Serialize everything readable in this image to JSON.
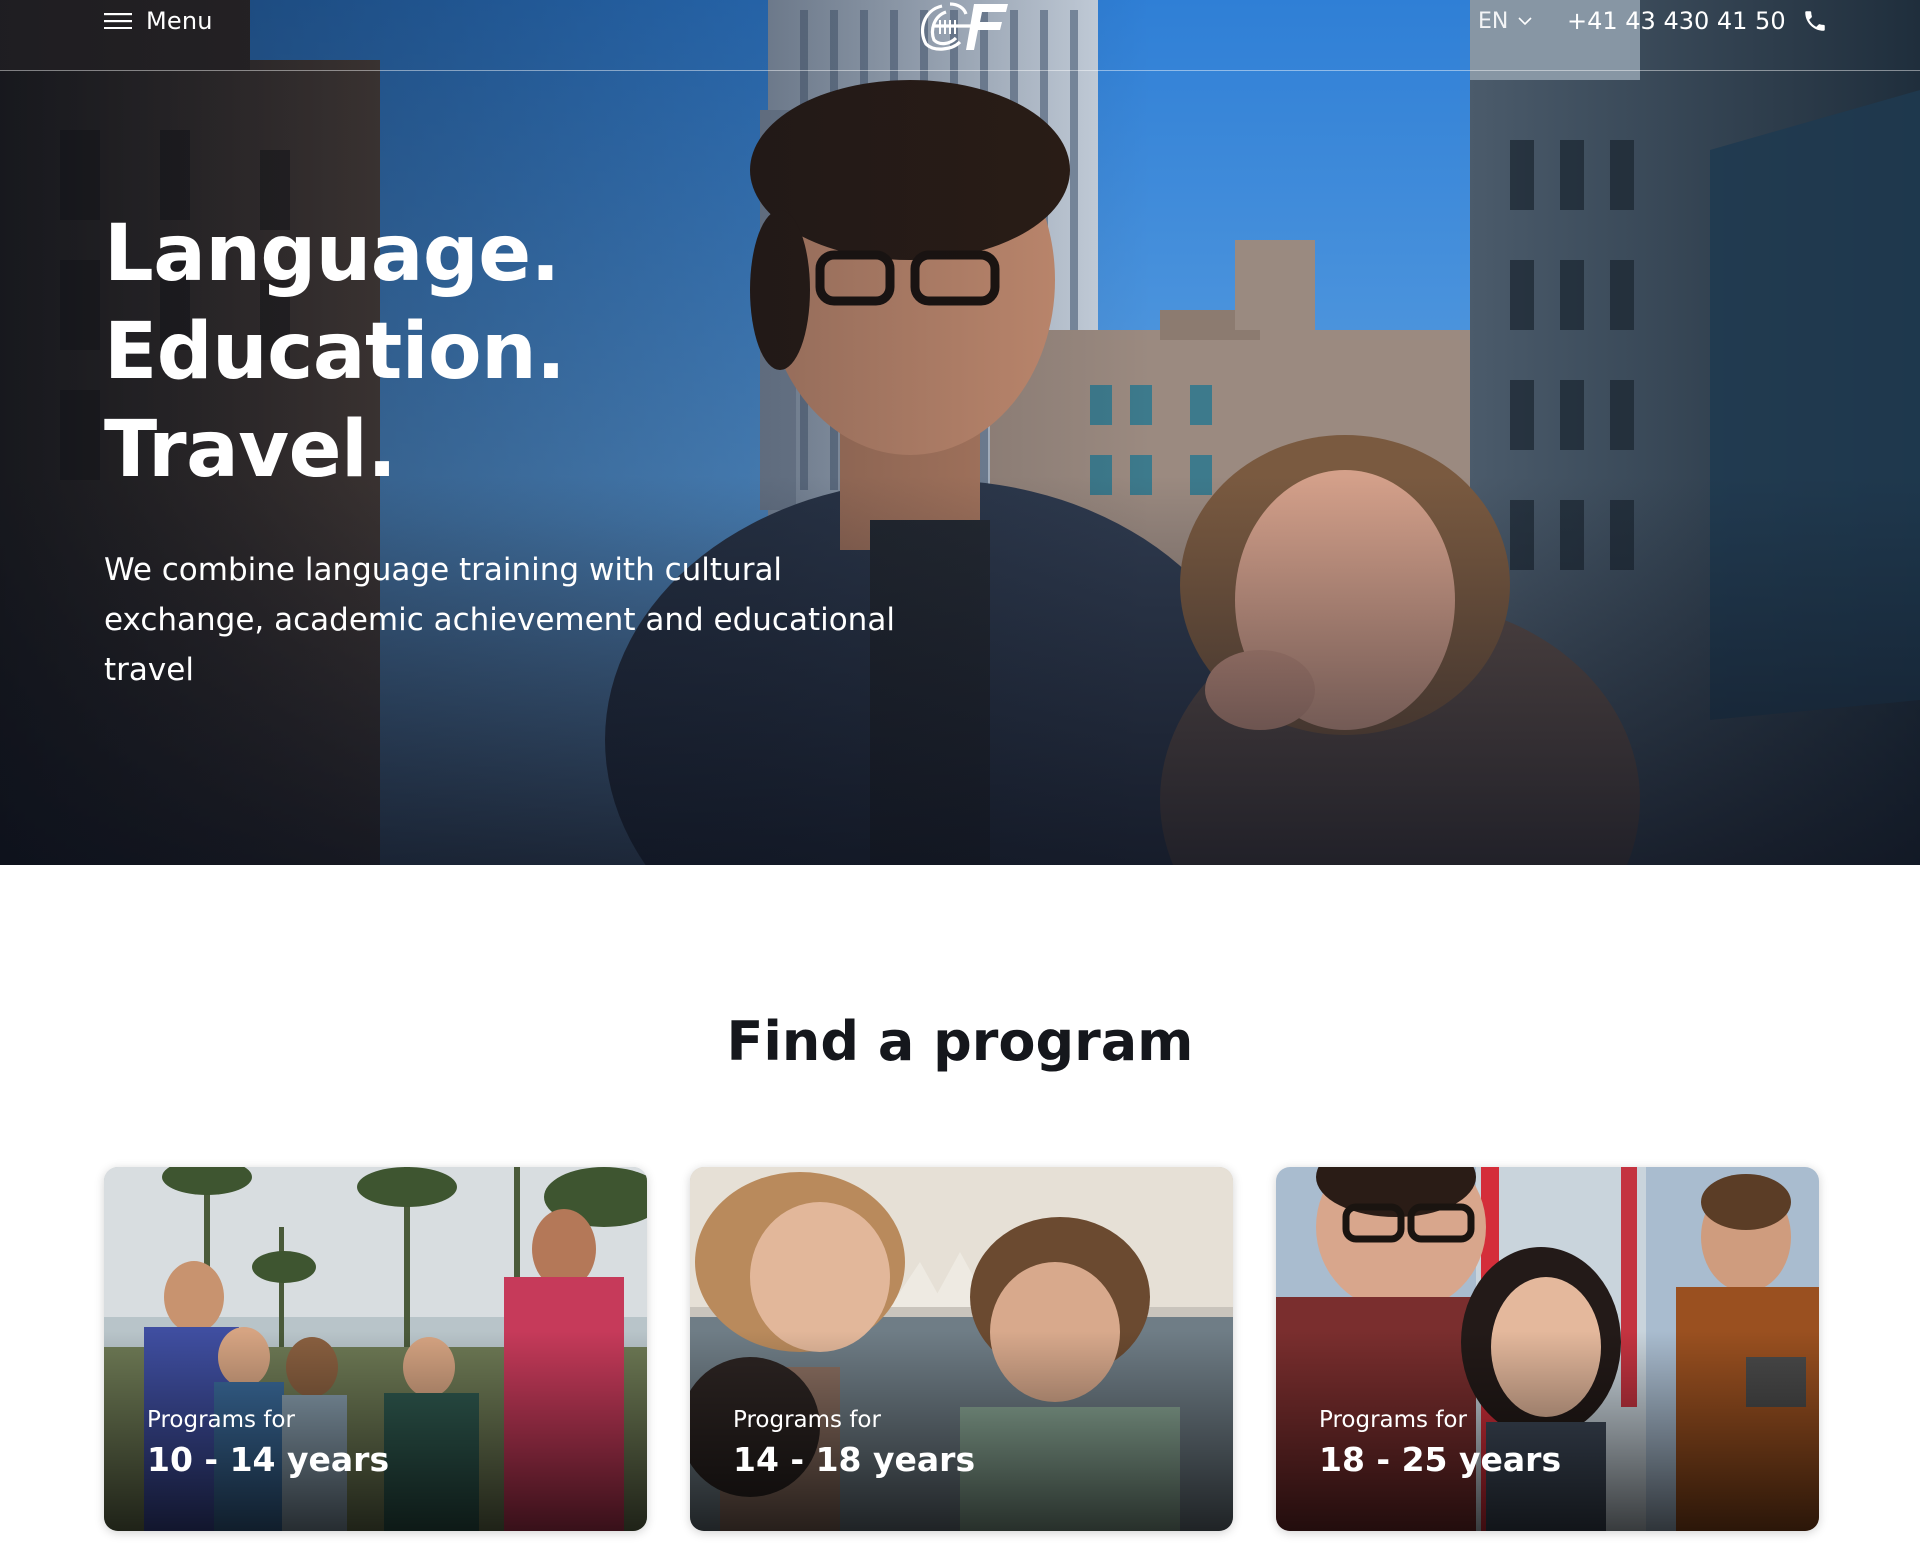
{
  "nav": {
    "menu_label": "Menu",
    "logo_text": "EF",
    "language": "EN",
    "phone": "+41 43 430 41 50"
  },
  "hero": {
    "title_lines": [
      "Language.",
      "Education.",
      "Travel."
    ],
    "subtitle": "We combine language training with cultural exchange, academic achievement and educational travel"
  },
  "programs": {
    "heading": "Find a program",
    "cards": [
      {
        "kicker": "Programs for",
        "title": "10 - 14 years"
      },
      {
        "kicker": "Programs for",
        "title": "14 - 18 years"
      },
      {
        "kicker": "Programs for",
        "title": "18 - 25 years"
      }
    ]
  },
  "icons": {
    "menu": "hamburger-icon",
    "language_dropdown": "chevron-down-icon",
    "phone": "phone-icon"
  },
  "colors": {
    "text_dark": "#15171c",
    "hero_text": "#ffffff",
    "sky": "#3f8fe0"
  }
}
